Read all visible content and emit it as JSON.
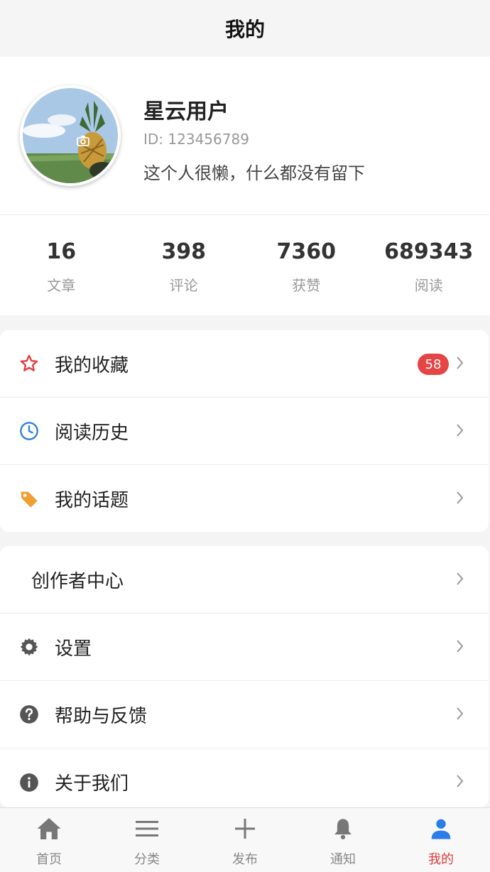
{
  "header": {
    "title": "我的"
  },
  "profile": {
    "nickname": "星云用户",
    "id_text": "ID: 123456789",
    "bio": "这个人很懒，什么都没有留下",
    "avatar_icon": "pineapple-photo"
  },
  "stats": [
    {
      "value": "16",
      "label": "文章"
    },
    {
      "value": "398",
      "label": "评论"
    },
    {
      "value": "7360",
      "label": "获赞"
    },
    {
      "value": "689343",
      "label": "阅读"
    }
  ],
  "menu1": [
    {
      "label": "我的收藏",
      "icon": "star-icon",
      "badge": "58"
    },
    {
      "label": "阅读历史",
      "icon": "clock-icon"
    },
    {
      "label": "我的话题",
      "icon": "tag-icon"
    }
  ],
  "menu2": [
    {
      "label": "创作者中心"
    },
    {
      "label": "设置",
      "icon": "gear-icon"
    },
    {
      "label": "帮助与反馈",
      "icon": "help-icon"
    },
    {
      "label": "关于我们",
      "icon": "info-icon"
    }
  ],
  "tabbar": [
    {
      "label": "首页",
      "icon": "home-icon"
    },
    {
      "label": "分类",
      "icon": "menu-icon"
    },
    {
      "label": "发布",
      "icon": "plus-icon"
    },
    {
      "label": "通知",
      "icon": "bell-icon"
    },
    {
      "label": "我的",
      "icon": "user-icon",
      "active": true
    }
  ],
  "colors": {
    "accent": "#e03c3c",
    "badge": "#e64545",
    "clock": "#2f7fd6",
    "tag": "#f0a030",
    "icon_gray": "#555555"
  }
}
